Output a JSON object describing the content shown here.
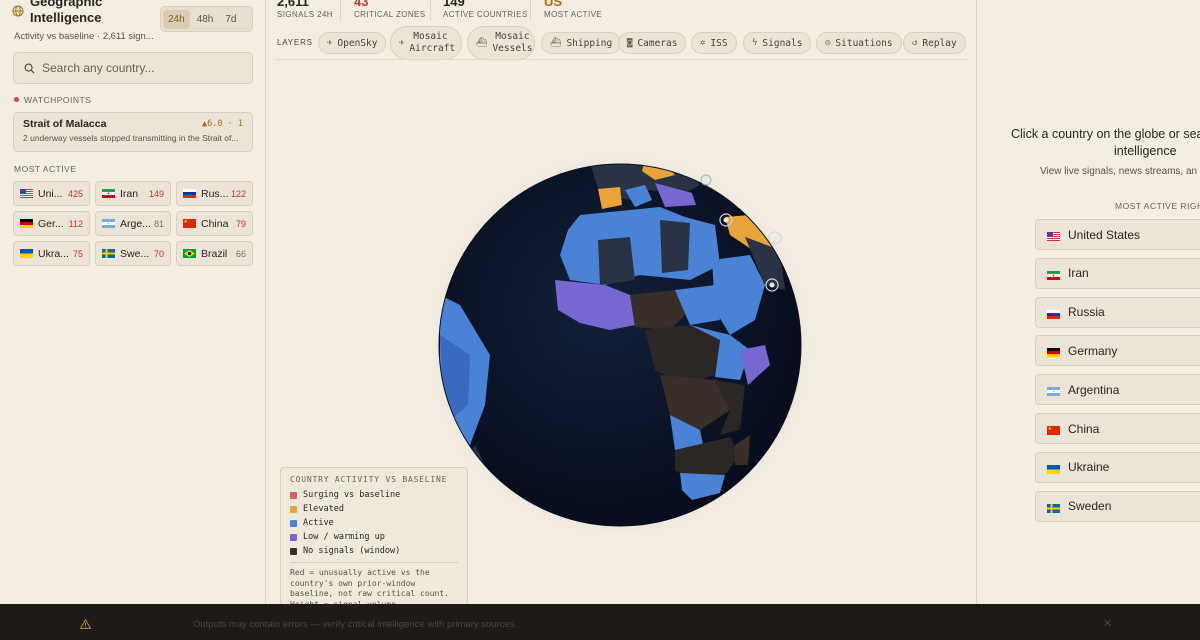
{
  "app": {
    "title": "Geographic Intelligence",
    "subtitle": "Activity vs baseline · 2,611 sign...",
    "ranges": [
      "24h",
      "48h",
      "7d"
    ],
    "active_range": "24h"
  },
  "search": {
    "placeholder": "Search any country..."
  },
  "watchpoints": {
    "label": "WATCHPOINTS",
    "items": [
      {
        "name": "Strait of Malacca",
        "meta": "▲6.0 · 1",
        "desc": "2 underway vessels stopped transmitting in the Strait of..."
      }
    ]
  },
  "most_active": {
    "label": "MOST ACTIVE",
    "items": [
      {
        "name": "Uni...",
        "count": "425",
        "flag": "us"
      },
      {
        "name": "Iran",
        "count": "149",
        "flag": "ir"
      },
      {
        "name": "Rus...",
        "count": "122",
        "flag": "ru"
      },
      {
        "name": "Ger...",
        "count": "112",
        "flag": "de"
      },
      {
        "name": "Arge...",
        "count": "81",
        "flag": "ar"
      },
      {
        "name": "China",
        "count": "79",
        "flag": "cn"
      },
      {
        "name": "Ukra...",
        "count": "75",
        "flag": "ua"
      },
      {
        "name": "Swe...",
        "count": "70",
        "flag": "se"
      },
      {
        "name": "Brazil",
        "count": "66",
        "flag": "br"
      }
    ]
  },
  "stats": [
    {
      "value": "2,611",
      "label": "SIGNALS 24H",
      "color": "#2a2520"
    },
    {
      "value": "43",
      "label": "CRITICAL ZONES",
      "color": "#c0392b"
    },
    {
      "value": "149",
      "label": "ACTIVE COUNTRIES",
      "color": "#2a2520"
    },
    {
      "value": "US",
      "label": "MOST ACTIVE",
      "color": "#b06a10"
    }
  ],
  "layers": {
    "label": "LAYERS",
    "buttons": [
      {
        "label": "OpenSky",
        "icon": "plane-icon"
      },
      {
        "label": "Mosaic Aircraft",
        "icon": "aircraft-icon"
      },
      {
        "label": "Mosaic Vessels",
        "icon": "vessel-icon"
      },
      {
        "label": "Shipping",
        "icon": "ship-icon"
      },
      {
        "label": "Cameras",
        "icon": "camera-icon"
      },
      {
        "label": "ISS",
        "icon": "satellite-icon"
      },
      {
        "label": "Signals",
        "icon": "bolt-icon"
      },
      {
        "label": "Situations",
        "icon": "target-icon"
      },
      {
        "label": "Replay",
        "icon": "history-icon"
      }
    ]
  },
  "legend": {
    "title": "COUNTRY ACTIVITY VS BASELINE",
    "items": [
      {
        "label": "Surging vs baseline",
        "color": "#e05d5d"
      },
      {
        "label": "Elevated",
        "color": "#e8a33a"
      },
      {
        "label": "Active",
        "color": "#4a82d6"
      },
      {
        "label": "Low / warming up",
        "color": "#7667d1"
      },
      {
        "label": "No signals (window)",
        "color": "#3a2e28"
      }
    ],
    "note": "Red = unusually active vs the country's own prior-window baseline, not raw critical count. Height = signal volume."
  },
  "right_panel": {
    "heading_line1": "Click a country on the globe or sea",
    "heading_line2": "intelligence",
    "sub": "View live signals, news streams, an",
    "label": "MOST ACTIVE RIGHT",
    "countries": [
      {
        "name": "United States",
        "flag": "us"
      },
      {
        "name": "Iran",
        "flag": "ir"
      },
      {
        "name": "Russia",
        "flag": "ru"
      },
      {
        "name": "Germany",
        "flag": "de"
      },
      {
        "name": "Argentina",
        "flag": "ar"
      },
      {
        "name": "China",
        "flag": "cn"
      },
      {
        "name": "Ukraine",
        "flag": "ua"
      },
      {
        "name": "Sweden",
        "flag": "se"
      }
    ]
  },
  "footer": {
    "text": "Outputs may contain errors — verify critical intelligence with primary sources.",
    "close": "✕"
  }
}
